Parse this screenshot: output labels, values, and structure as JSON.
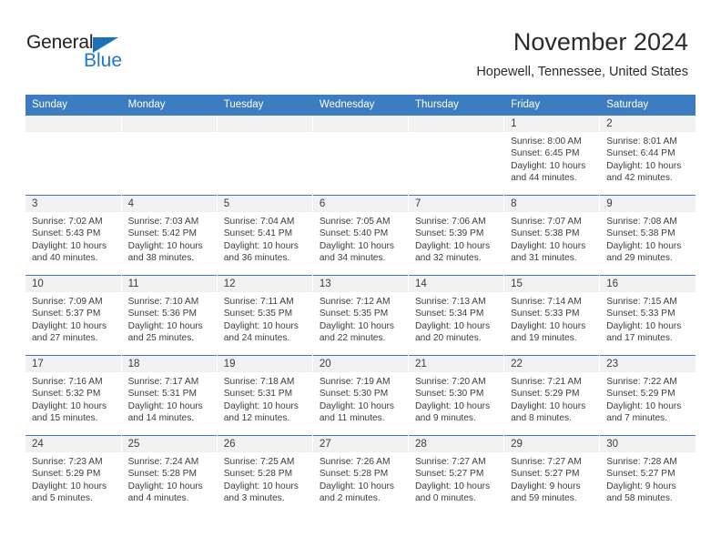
{
  "brand": {
    "name_top": "General",
    "name_bottom": "Blue",
    "triangle_color": "#1d70b8",
    "text_color": "#231f20",
    "blue_text_color": "#2277c8"
  },
  "header": {
    "title": "November 2024",
    "subtitle": "Hopewell, Tennessee, United States"
  },
  "theme": {
    "header_blue": "#3b7dc0",
    "daynum_band": "#f1f1f1",
    "text": "#3c3c3c"
  },
  "calendar": {
    "weekday_headers": [
      "Sunday",
      "Monday",
      "Tuesday",
      "Wednesday",
      "Thursday",
      "Friday",
      "Saturday"
    ],
    "weeks": [
      [
        {
          "day": "",
          "sunrise": "",
          "sunset": "",
          "daylight_line1": "",
          "daylight_line2": ""
        },
        {
          "day": "",
          "sunrise": "",
          "sunset": "",
          "daylight_line1": "",
          "daylight_line2": ""
        },
        {
          "day": "",
          "sunrise": "",
          "sunset": "",
          "daylight_line1": "",
          "daylight_line2": ""
        },
        {
          "day": "",
          "sunrise": "",
          "sunset": "",
          "daylight_line1": "",
          "daylight_line2": ""
        },
        {
          "day": "",
          "sunrise": "",
          "sunset": "",
          "daylight_line1": "",
          "daylight_line2": ""
        },
        {
          "day": "1",
          "sunrise": "Sunrise: 8:00 AM",
          "sunset": "Sunset: 6:45 PM",
          "daylight_line1": "Daylight: 10 hours",
          "daylight_line2": "and 44 minutes."
        },
        {
          "day": "2",
          "sunrise": "Sunrise: 8:01 AM",
          "sunset": "Sunset: 6:44 PM",
          "daylight_line1": "Daylight: 10 hours",
          "daylight_line2": "and 42 minutes."
        }
      ],
      [
        {
          "day": "3",
          "sunrise": "Sunrise: 7:02 AM",
          "sunset": "Sunset: 5:43 PM",
          "daylight_line1": "Daylight: 10 hours",
          "daylight_line2": "and 40 minutes."
        },
        {
          "day": "4",
          "sunrise": "Sunrise: 7:03 AM",
          "sunset": "Sunset: 5:42 PM",
          "daylight_line1": "Daylight: 10 hours",
          "daylight_line2": "and 38 minutes."
        },
        {
          "day": "5",
          "sunrise": "Sunrise: 7:04 AM",
          "sunset": "Sunset: 5:41 PM",
          "daylight_line1": "Daylight: 10 hours",
          "daylight_line2": "and 36 minutes."
        },
        {
          "day": "6",
          "sunrise": "Sunrise: 7:05 AM",
          "sunset": "Sunset: 5:40 PM",
          "daylight_line1": "Daylight: 10 hours",
          "daylight_line2": "and 34 minutes."
        },
        {
          "day": "7",
          "sunrise": "Sunrise: 7:06 AM",
          "sunset": "Sunset: 5:39 PM",
          "daylight_line1": "Daylight: 10 hours",
          "daylight_line2": "and 32 minutes."
        },
        {
          "day": "8",
          "sunrise": "Sunrise: 7:07 AM",
          "sunset": "Sunset: 5:38 PM",
          "daylight_line1": "Daylight: 10 hours",
          "daylight_line2": "and 31 minutes."
        },
        {
          "day": "9",
          "sunrise": "Sunrise: 7:08 AM",
          "sunset": "Sunset: 5:38 PM",
          "daylight_line1": "Daylight: 10 hours",
          "daylight_line2": "and 29 minutes."
        }
      ],
      [
        {
          "day": "10",
          "sunrise": "Sunrise: 7:09 AM",
          "sunset": "Sunset: 5:37 PM",
          "daylight_line1": "Daylight: 10 hours",
          "daylight_line2": "and 27 minutes."
        },
        {
          "day": "11",
          "sunrise": "Sunrise: 7:10 AM",
          "sunset": "Sunset: 5:36 PM",
          "daylight_line1": "Daylight: 10 hours",
          "daylight_line2": "and 25 minutes."
        },
        {
          "day": "12",
          "sunrise": "Sunrise: 7:11 AM",
          "sunset": "Sunset: 5:35 PM",
          "daylight_line1": "Daylight: 10 hours",
          "daylight_line2": "and 24 minutes."
        },
        {
          "day": "13",
          "sunrise": "Sunrise: 7:12 AM",
          "sunset": "Sunset: 5:35 PM",
          "daylight_line1": "Daylight: 10 hours",
          "daylight_line2": "and 22 minutes."
        },
        {
          "day": "14",
          "sunrise": "Sunrise: 7:13 AM",
          "sunset": "Sunset: 5:34 PM",
          "daylight_line1": "Daylight: 10 hours",
          "daylight_line2": "and 20 minutes."
        },
        {
          "day": "15",
          "sunrise": "Sunrise: 7:14 AM",
          "sunset": "Sunset: 5:33 PM",
          "daylight_line1": "Daylight: 10 hours",
          "daylight_line2": "and 19 minutes."
        },
        {
          "day": "16",
          "sunrise": "Sunrise: 7:15 AM",
          "sunset": "Sunset: 5:33 PM",
          "daylight_line1": "Daylight: 10 hours",
          "daylight_line2": "and 17 minutes."
        }
      ],
      [
        {
          "day": "17",
          "sunrise": "Sunrise: 7:16 AM",
          "sunset": "Sunset: 5:32 PM",
          "daylight_line1": "Daylight: 10 hours",
          "daylight_line2": "and 15 minutes."
        },
        {
          "day": "18",
          "sunrise": "Sunrise: 7:17 AM",
          "sunset": "Sunset: 5:31 PM",
          "daylight_line1": "Daylight: 10 hours",
          "daylight_line2": "and 14 minutes."
        },
        {
          "day": "19",
          "sunrise": "Sunrise: 7:18 AM",
          "sunset": "Sunset: 5:31 PM",
          "daylight_line1": "Daylight: 10 hours",
          "daylight_line2": "and 12 minutes."
        },
        {
          "day": "20",
          "sunrise": "Sunrise: 7:19 AM",
          "sunset": "Sunset: 5:30 PM",
          "daylight_line1": "Daylight: 10 hours",
          "daylight_line2": "and 11 minutes."
        },
        {
          "day": "21",
          "sunrise": "Sunrise: 7:20 AM",
          "sunset": "Sunset: 5:30 PM",
          "daylight_line1": "Daylight: 10 hours",
          "daylight_line2": "and 9 minutes."
        },
        {
          "day": "22",
          "sunrise": "Sunrise: 7:21 AM",
          "sunset": "Sunset: 5:29 PM",
          "daylight_line1": "Daylight: 10 hours",
          "daylight_line2": "and 8 minutes."
        },
        {
          "day": "23",
          "sunrise": "Sunrise: 7:22 AM",
          "sunset": "Sunset: 5:29 PM",
          "daylight_line1": "Daylight: 10 hours",
          "daylight_line2": "and 7 minutes."
        }
      ],
      [
        {
          "day": "24",
          "sunrise": "Sunrise: 7:23 AM",
          "sunset": "Sunset: 5:29 PM",
          "daylight_line1": "Daylight: 10 hours",
          "daylight_line2": "and 5 minutes."
        },
        {
          "day": "25",
          "sunrise": "Sunrise: 7:24 AM",
          "sunset": "Sunset: 5:28 PM",
          "daylight_line1": "Daylight: 10 hours",
          "daylight_line2": "and 4 minutes."
        },
        {
          "day": "26",
          "sunrise": "Sunrise: 7:25 AM",
          "sunset": "Sunset: 5:28 PM",
          "daylight_line1": "Daylight: 10 hours",
          "daylight_line2": "and 3 minutes."
        },
        {
          "day": "27",
          "sunrise": "Sunrise: 7:26 AM",
          "sunset": "Sunset: 5:28 PM",
          "daylight_line1": "Daylight: 10 hours",
          "daylight_line2": "and 2 minutes."
        },
        {
          "day": "28",
          "sunrise": "Sunrise: 7:27 AM",
          "sunset": "Sunset: 5:27 PM",
          "daylight_line1": "Daylight: 10 hours",
          "daylight_line2": "and 0 minutes."
        },
        {
          "day": "29",
          "sunrise": "Sunrise: 7:27 AM",
          "sunset": "Sunset: 5:27 PM",
          "daylight_line1": "Daylight: 9 hours",
          "daylight_line2": "and 59 minutes."
        },
        {
          "day": "30",
          "sunrise": "Sunrise: 7:28 AM",
          "sunset": "Sunset: 5:27 PM",
          "daylight_line1": "Daylight: 9 hours",
          "daylight_line2": "and 58 minutes."
        }
      ]
    ]
  }
}
